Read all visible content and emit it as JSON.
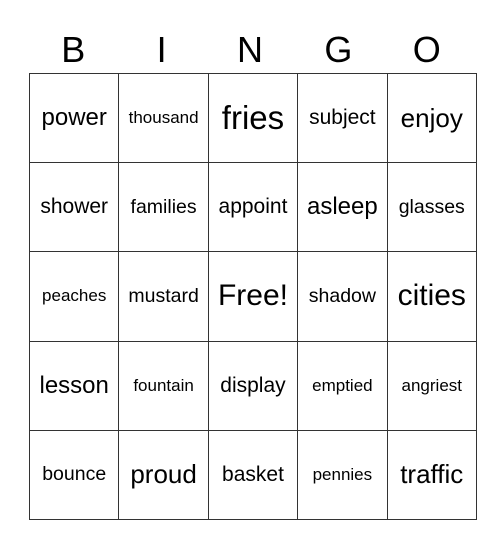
{
  "header": [
    "B",
    "I",
    "N",
    "G",
    "O"
  ],
  "rows": [
    [
      "power",
      "thousand",
      "fries",
      "subject",
      "enjoy"
    ],
    [
      "shower",
      "families",
      "appoint",
      "asleep",
      "glasses"
    ],
    [
      "peaches",
      "mustard",
      "Free!",
      "shadow",
      "cities"
    ],
    [
      "lesson",
      "fountain",
      "display",
      "emptied",
      "angriest"
    ],
    [
      "bounce",
      "proud",
      "basket",
      "pennies",
      "traffic"
    ]
  ]
}
